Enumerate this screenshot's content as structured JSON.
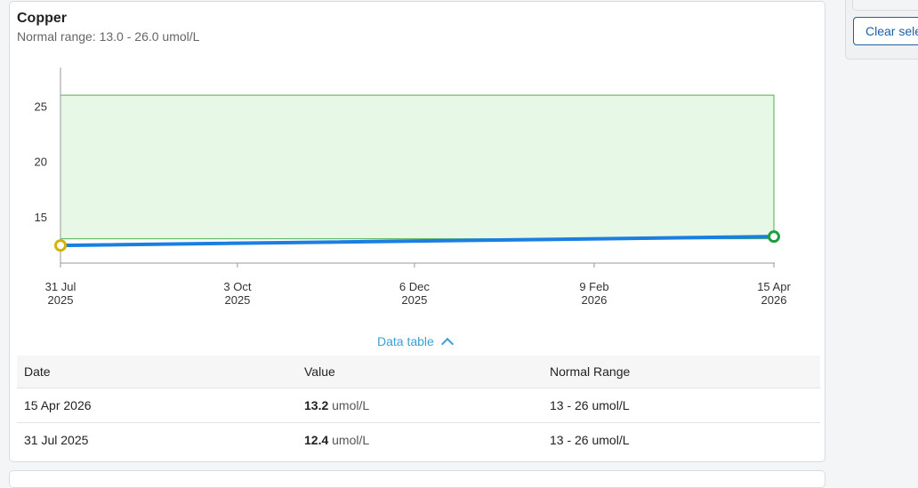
{
  "card": {
    "title": "Copper",
    "subtitle": "Normal range: 13.0 - 26.0 umol/L"
  },
  "chart_data": {
    "type": "line",
    "x_ticks": [
      {
        "date": "2025-07-31",
        "line1": "31 Jul",
        "line2": "2025"
      },
      {
        "date": "2025-10-03",
        "line1": "3 Oct",
        "line2": "2025"
      },
      {
        "date": "2025-12-06",
        "line1": "6 Dec",
        "line2": "2025"
      },
      {
        "date": "2026-02-09",
        "line1": "9 Feb",
        "line2": "2026"
      },
      {
        "date": "2026-04-15",
        "line1": "15 Apr",
        "line2": "2026"
      }
    ],
    "y_ticks": [
      15,
      20,
      25
    ],
    "ylim": [
      10.8,
      28.5
    ],
    "normal_range": [
      13,
      26
    ],
    "points": [
      {
        "date": "2025-07-31",
        "value": 12.4,
        "color": "#d4b400"
      },
      {
        "date": "2026-04-15",
        "value": 13.2,
        "color": "#1e9e3e"
      }
    ],
    "line_color": "#1a7fe0",
    "range_fill": "#e8f8e6",
    "range_stroke": "#4caf50",
    "grid": false
  },
  "data_table": {
    "toggle_label": "Data table",
    "headers": {
      "date": "Date",
      "value": "Value",
      "range": "Normal Range"
    },
    "rows": [
      {
        "date": "15 Apr 2026",
        "value": "13.2",
        "unit": "umol/L",
        "range": "13 - 26 umol/L"
      },
      {
        "date": "31 Jul 2025",
        "value": "12.4",
        "unit": "umol/L",
        "range": "13 - 26 umol/L"
      }
    ]
  },
  "right_panel": {
    "clear_button": "Clear sele"
  }
}
